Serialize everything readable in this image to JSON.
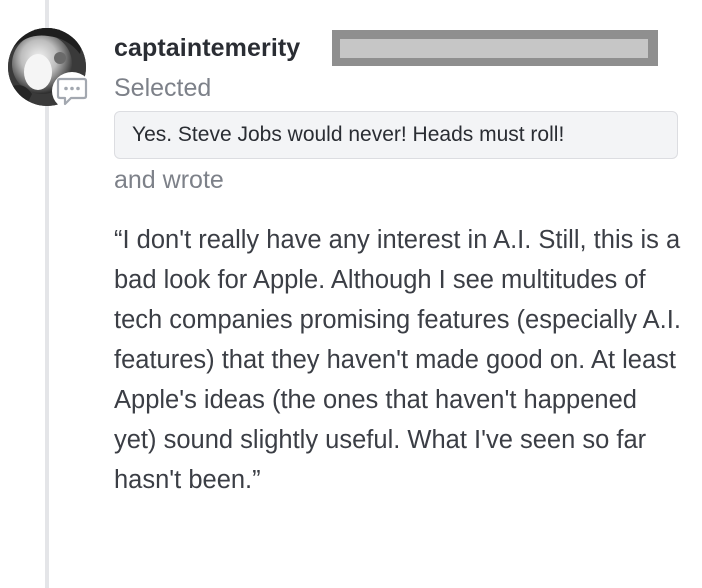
{
  "comment": {
    "username": "captaintemerity",
    "selected_label": "Selected",
    "selected_quote": "Yes. Steve Jobs would never! Heads must roll!",
    "wrote_label": "and wrote",
    "body": "“I don't really have any interest in A.I. Still, this is a bad look for Apple. Although I see multitudes of tech companies promising features (especially A.I. features) that they haven't made good on. At least Apple's ideas (the ones that haven't happened yet) sound slightly useful. What I've seen so far hasn't been.”"
  },
  "icons": {
    "avatar": "avatar-photo",
    "badge": "speech-bubble-icon"
  },
  "colors": {
    "text_primary": "#2a2d33",
    "text_muted": "#7d8189",
    "chip_bg": "#f3f4f6",
    "thread_line": "#e4e5e8",
    "badge_icon": "#a3a8b0",
    "redaction": "#8f8f8f"
  }
}
